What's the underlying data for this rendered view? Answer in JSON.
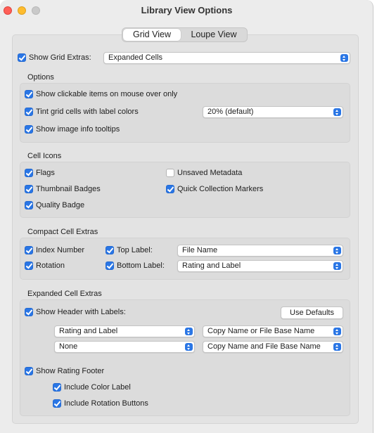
{
  "window": {
    "title": "Library View Options"
  },
  "tabs": [
    {
      "label": "Grid View",
      "selected": true
    },
    {
      "label": "Loupe View",
      "selected": false
    }
  ],
  "colors": {
    "accent": "#2a76e5",
    "close": "#ff5f57",
    "minimize": "#febc2e"
  },
  "show_grid_extras": {
    "label": "Show Grid Extras:",
    "checked": true,
    "select_value": "Expanded Cells"
  },
  "options": {
    "header": "Options",
    "show_clickable": {
      "label": "Show clickable items on mouse over only",
      "checked": true
    },
    "tint_grid": {
      "label": "Tint grid cells with label colors",
      "checked": true,
      "select_value": "20% (default)"
    },
    "show_tooltips": {
      "label": "Show image info tooltips",
      "checked": true
    }
  },
  "cell_icons": {
    "header": "Cell Icons",
    "flags": {
      "label": "Flags",
      "checked": true
    },
    "unsaved_metadata": {
      "label": "Unsaved Metadata",
      "checked": false
    },
    "thumbnail_badges": {
      "label": "Thumbnail Badges",
      "checked": true
    },
    "quick_collection_markers": {
      "label": "Quick Collection Markers",
      "checked": true
    },
    "quality_badge": {
      "label": "Quality Badge",
      "checked": true
    }
  },
  "compact": {
    "header": "Compact Cell Extras",
    "index_number": {
      "label": "Index Number",
      "checked": true
    },
    "top_label": {
      "label": "Top Label:",
      "checked": true,
      "select_value": "File Name"
    },
    "rotation": {
      "label": "Rotation",
      "checked": true
    },
    "bottom_label": {
      "label": "Bottom Label:",
      "checked": true,
      "select_value": "Rating and Label"
    }
  },
  "expanded": {
    "header": "Expanded Cell Extras",
    "show_header": {
      "label": "Show Header with Labels:",
      "checked": true
    },
    "use_defaults": "Use Defaults",
    "label_1": "Rating and Label",
    "label_2": "Copy Name or File Base Name",
    "label_3": "None",
    "label_4": "Copy Name and File Base Name",
    "show_rating_footer": {
      "label": "Show Rating Footer",
      "checked": true
    },
    "include_color_label": {
      "label": "Include Color Label",
      "checked": true
    },
    "include_rotation_buttons": {
      "label": "Include Rotation Buttons",
      "checked": true
    }
  }
}
